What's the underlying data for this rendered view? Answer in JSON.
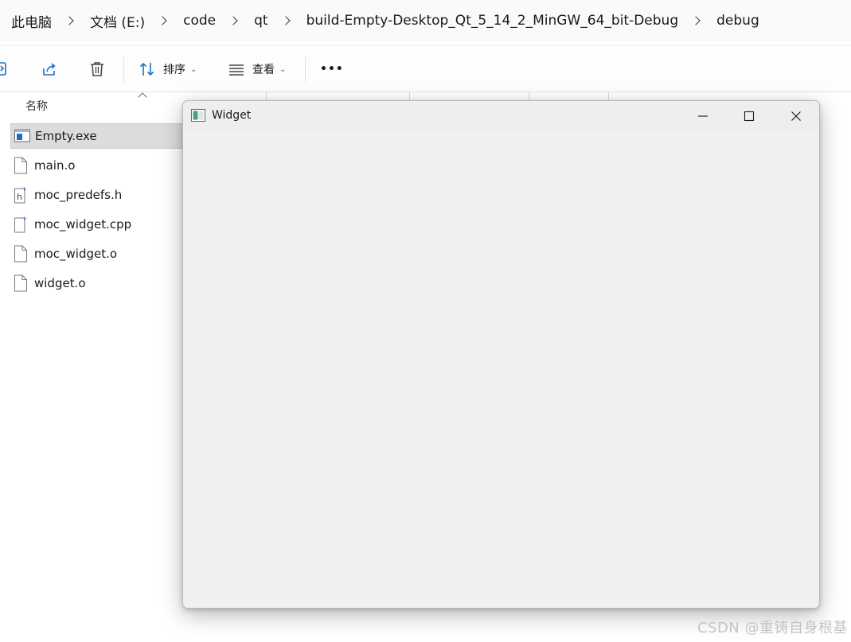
{
  "breadcrumb": {
    "items": [
      "此电脑",
      "文档 (E:)",
      "code",
      "qt",
      "build-Empty-Desktop_Qt_5_14_2_MinGW_64_bit-Debug",
      "debug"
    ]
  },
  "toolbar": {
    "sort_label": "排序",
    "view_label": "查看",
    "more_label": "•••"
  },
  "file_list": {
    "column_name": "名称",
    "files": [
      {
        "name": "Empty.exe",
        "icon": "exe-icon",
        "selected": true
      },
      {
        "name": "main.o",
        "icon": "file-icon",
        "selected": false
      },
      {
        "name": "moc_predefs.h",
        "icon": "header-file-icon",
        "selected": false
      },
      {
        "name": "moc_widget.cpp",
        "icon": "cpp-file-icon",
        "selected": false
      },
      {
        "name": "moc_widget.o",
        "icon": "file-icon",
        "selected": false
      },
      {
        "name": "widget.o",
        "icon": "file-icon",
        "selected": false
      }
    ]
  },
  "qt_window": {
    "title": "Widget",
    "background": "#f0f0f0"
  },
  "watermark": "CSDN @重铸自身根基",
  "colors": {
    "selected_row": "#dcdcdc",
    "accent_blue": "#1f6fc7",
    "badge_purple": "#9b3fb5"
  }
}
